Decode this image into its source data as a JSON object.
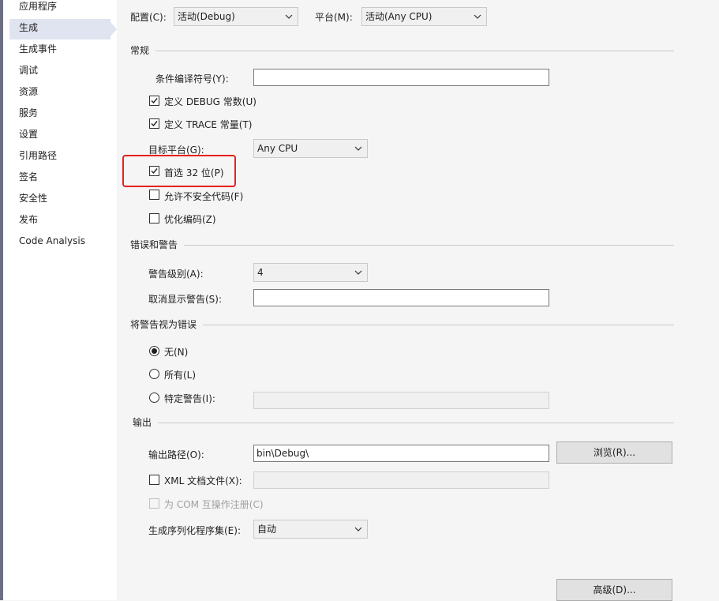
{
  "sidebar": {
    "items": [
      {
        "label": "应用程序"
      },
      {
        "label": "生成"
      },
      {
        "label": "生成事件"
      },
      {
        "label": "调试"
      },
      {
        "label": "资源"
      },
      {
        "label": "服务"
      },
      {
        "label": "设置"
      },
      {
        "label": "引用路径"
      },
      {
        "label": "签名"
      },
      {
        "label": "安全性"
      },
      {
        "label": "发布"
      },
      {
        "label": "Code Analysis"
      }
    ],
    "active_index": 1
  },
  "top": {
    "config_label": "配置(C):",
    "config_value": "活动(Debug)",
    "platform_label": "平台(M):",
    "platform_value": "活动(Any CPU)"
  },
  "general": {
    "title": "常规",
    "conditional_symbols_label": "条件编译符号(Y):",
    "conditional_symbols_value": "",
    "define_debug_label": "定义 DEBUG 常数(U)",
    "define_debug_checked": true,
    "define_trace_label": "定义 TRACE 常量(T)",
    "define_trace_checked": true,
    "target_platform_label": "目标平台(G):",
    "target_platform_value": "Any CPU",
    "prefer32_label": "首选 32 位(P)",
    "prefer32_checked": true,
    "allow_unsafe_label": "允许不安全代码(F)",
    "allow_unsafe_checked": false,
    "optimize_label": "优化编码(Z)",
    "optimize_checked": false
  },
  "errors": {
    "title": "错误和警告",
    "warning_level_label": "警告级别(A):",
    "warning_level_value": "4",
    "suppress_label": "取消显示警告(S):",
    "suppress_value": ""
  },
  "treat_warnings": {
    "title": "将警告视为错误",
    "none_label": "无(N)",
    "all_label": "所有(L)",
    "specific_label": "特定警告(I):",
    "selected": "none",
    "specific_value": ""
  },
  "output": {
    "title": "输出",
    "path_label": "输出路径(O):",
    "path_value": "bin\\Debug\\",
    "browse_label": "浏览(R)...",
    "xml_doc_label": "XML 文档文件(X):",
    "xml_doc_checked": false,
    "xml_doc_value": "",
    "com_label": "为 COM 互操作注册(C)",
    "com_checked": false,
    "serialization_label": "生成序列化程序集(E):",
    "serialization_value": "自动"
  },
  "advanced_label": "高级(D)..."
}
